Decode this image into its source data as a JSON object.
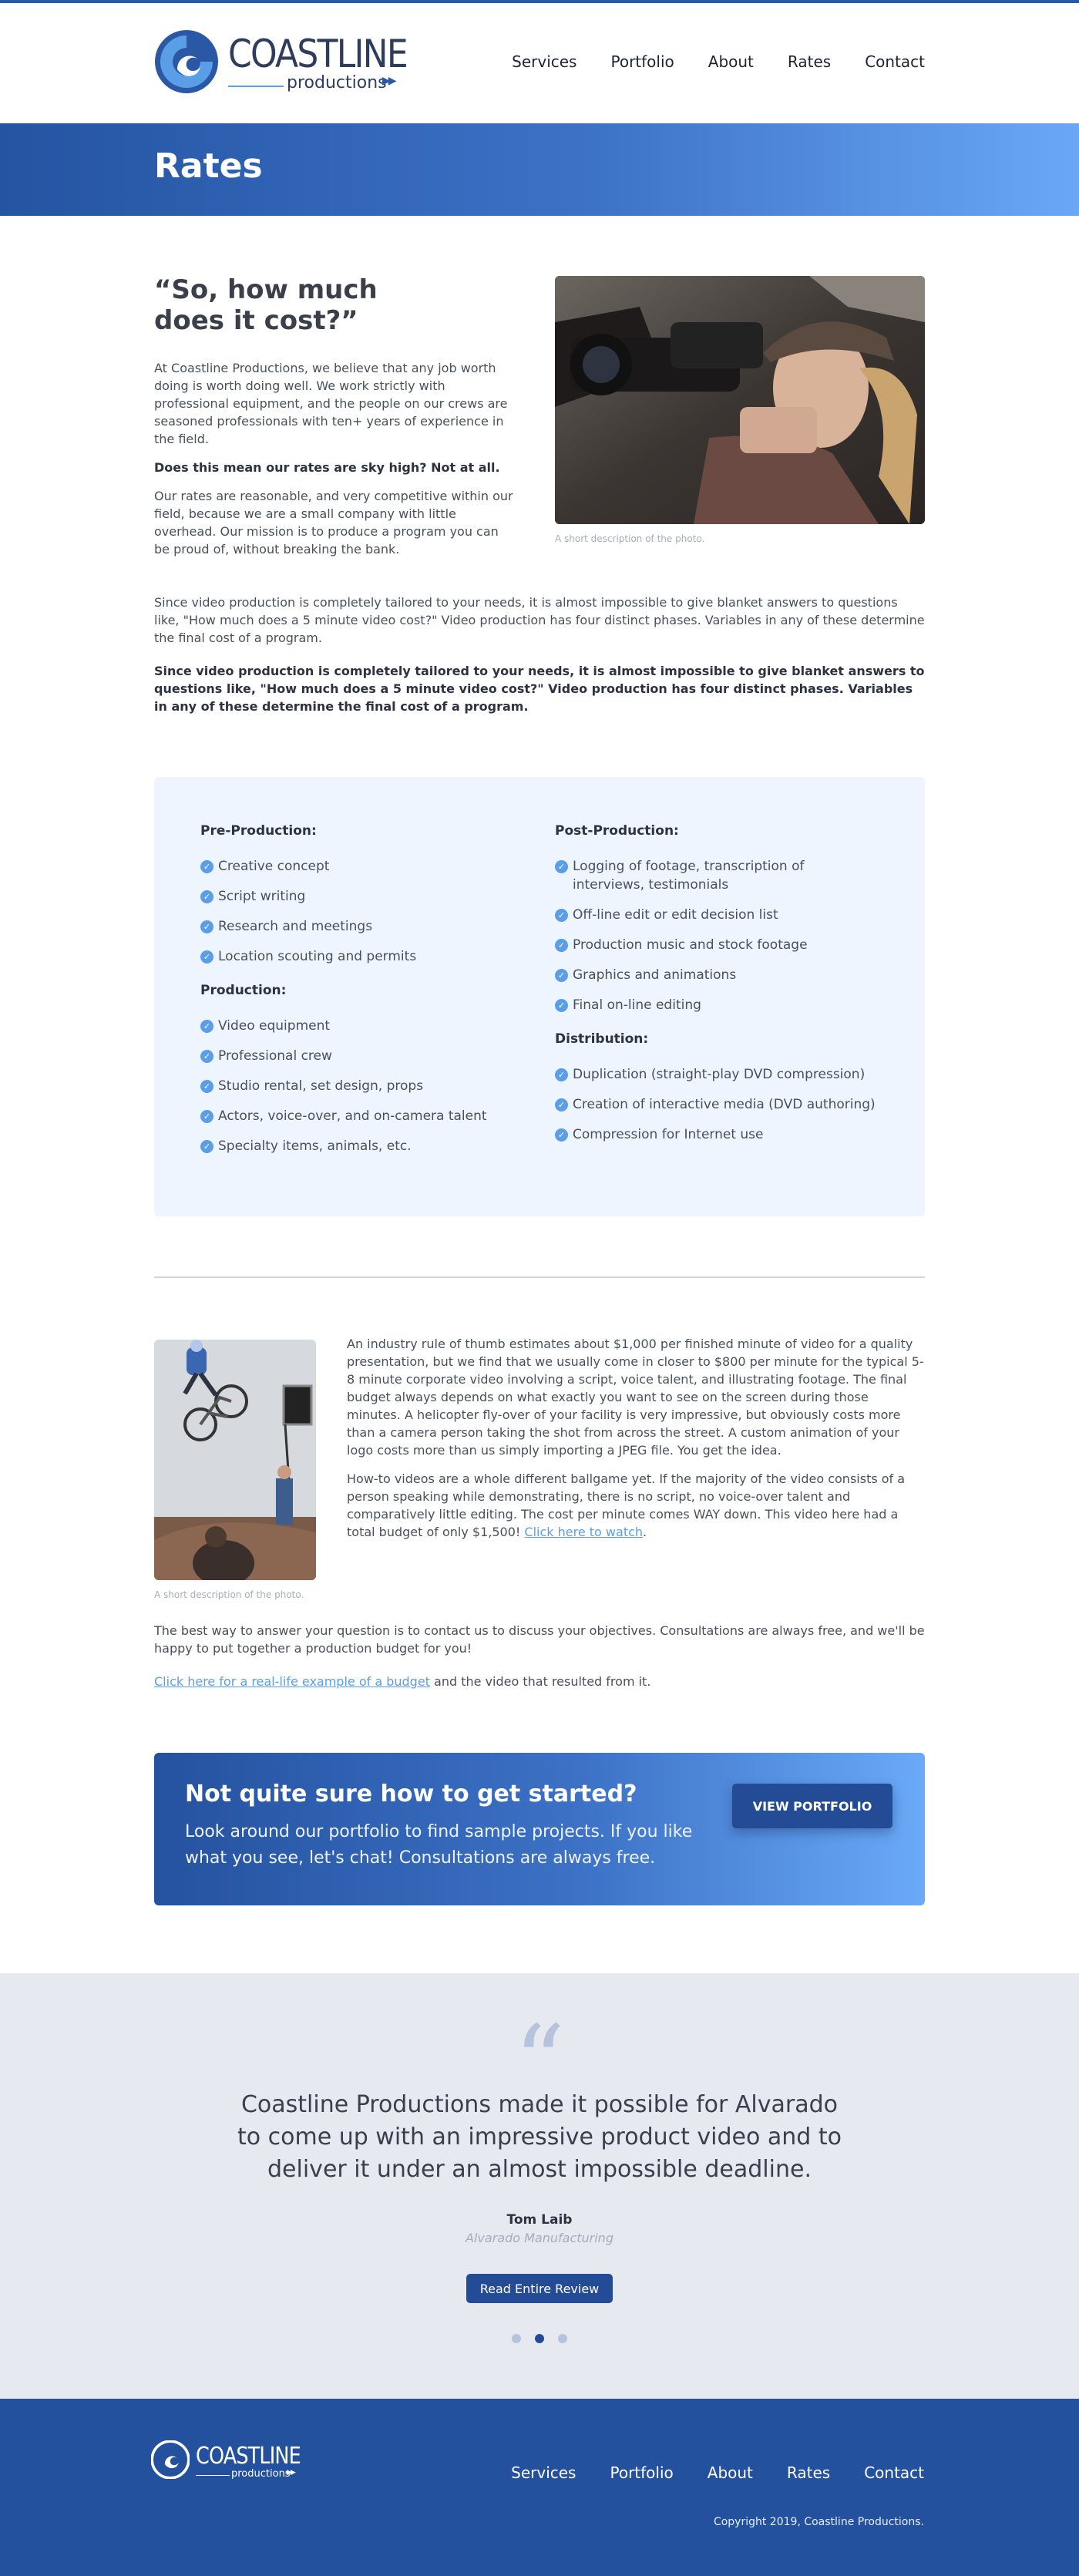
{
  "header": {
    "logo_word": "COASTLINE",
    "logo_sub": "productions",
    "nav": [
      "Services",
      "Portfolio",
      "About",
      "Rates",
      "Contact"
    ]
  },
  "banner": {
    "title": "Rates"
  },
  "intro": {
    "heading": "“So, how much does it cost?”",
    "p1": "At Coastline Productions, we believe that any job worth doing is worth doing well. We work strictly with professional equipment, and the people on our crews are seasoned professionals with ten+ years of experience in the field.",
    "p2_bold": "Does this mean our rates are sky high? Not at all.",
    "p3": "Our rates are reasonable, and very competitive within our field, because we are a small company with little overhead. Our mission is to produce a program you can be proud of, without breaking the bank.",
    "photo_caption": "A short description of the photo.",
    "p4": "Since video production is completely tailored to your needs, it is almost impossible to give blanket answers to questions like, \"How much does a 5 minute video cost?\" Video production has four distinct phases. Variables in any of these determine the final cost of a program.",
    "p5_bold": "Since video production is completely tailored to your needs, it is almost impossible to give blanket answers to questions like, \"How much does a 5 minute video cost?\" Video production has four distinct phases. Variables in any of these determine the final cost of a program."
  },
  "services": {
    "pre_production": {
      "title": "Pre-Production:",
      "items": [
        "Creative concept",
        "Script writing",
        "Research and meetings",
        "Location scouting and permits"
      ]
    },
    "production": {
      "title": "Production:",
      "items": [
        "Video equipment",
        "Professional crew",
        "Studio rental, set design, props",
        "Actors, voice-over, and on-camera talent",
        "Specialty items, animals, etc."
      ]
    },
    "post_production": {
      "title": "Post-Production:",
      "items": [
        "Logging of footage, transcription of interviews, testimonials",
        "Off-line edit or edit decision list",
        "Production music and stock footage",
        "Graphics and animations",
        "Final on-line editing"
      ]
    },
    "distribution": {
      "title": "Distribution:",
      "items": [
        "Duplication (straight-play DVD compression)",
        "Creation of interactive media (DVD authoring)",
        "Compression for Internet use"
      ]
    }
  },
  "section2": {
    "photo_caption": "A short description of the photo.",
    "p1": "An industry rule of thumb estimates about $1,000 per finished minute of video for a quality presentation, but we find that we usually come in closer to $800 per minute for the typical 5-8 minute corporate video involving a script, voice talent, and illustrating footage. The final budget always depends on what exactly you want to see on the screen during those minutes. A helicopter fly-over of your facility is very impressive, but obviously costs more than a camera person taking the shot from across the street. A custom animation of your logo costs more than us simply importing a JPEG file. You get the idea.",
    "p2": "How-to videos are a whole different ballgame yet. If the majority of the video consists of a person speaking while demonstrating, there is no script, no voice-over talent and comparatively little editing. The cost per minute comes WAY down. This video here had a total budget of only $1,500!",
    "p2_link": "Click here to watch",
    "p2_end": ".",
    "p3": "The best way to answer your question is to contact us to discuss your objectives. Consultations are always free, and we'll be happy to put together a production budget for you!",
    "p4_link": "Click here for a real-life example of a budget",
    "p4_rest": " and the video that resulted from it."
  },
  "cta": {
    "title": "Not quite sure how to get started?",
    "text": "Look around our portfolio to find sample projects. If you like what you see, let's chat! Consultations are always free.",
    "button": "VIEW PORTFOLIO"
  },
  "testimonial": {
    "quote": "Coastline Productions made it possible for Alvarado to come up with an impressive product video and to deliver it under an almost impossible deadline.",
    "name": "Tom Laib",
    "company": "Alvarado Manufacturing",
    "button": "Read Entire Review",
    "active_dot": 2
  },
  "footer": {
    "logo_word": "COASTLINE",
    "logo_sub": "productions",
    "nav": [
      "Services",
      "Portfolio",
      "About",
      "Rates",
      "Contact"
    ],
    "copyright": "Copyright 2019, Coastline Productions."
  },
  "colors": {
    "brand": "#2b58a5",
    "accent": "#5b9ee8",
    "footer": "#23519d",
    "cta_button": "#244c96"
  },
  "icons": [
    "logo-mark",
    "check-icon",
    "quote-icon"
  ]
}
